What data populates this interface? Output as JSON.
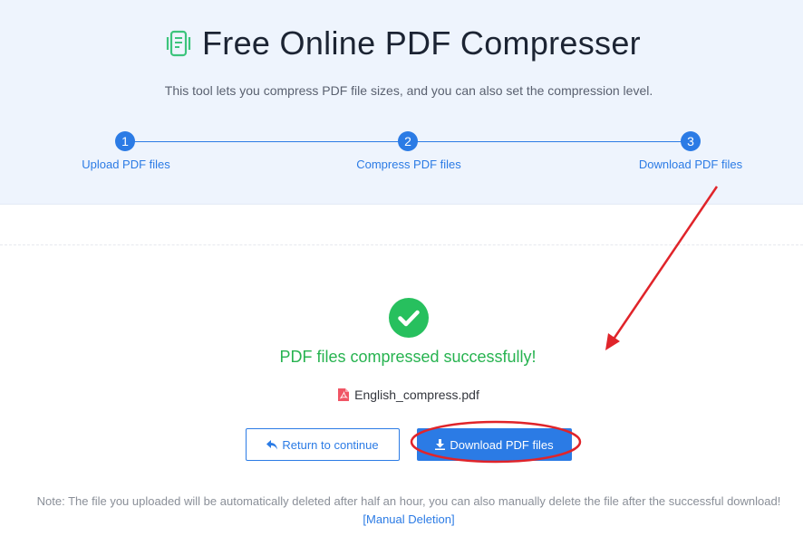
{
  "header": {
    "title": "Free Online PDF Compresser",
    "subtitle": "This tool lets you compress PDF file sizes, and you can also set the compression level.",
    "icon": "document-compress-icon"
  },
  "steps": [
    {
      "number": "1",
      "label": "Upload PDF files"
    },
    {
      "number": "2",
      "label": "Compress PDF files"
    },
    {
      "number": "3",
      "label": "Download PDF files"
    }
  ],
  "result": {
    "status_icon": "check-circle-icon",
    "message": "PDF files compressed successfully!",
    "file_icon": "pdf-file-icon",
    "file_name": "English_compress.pdf"
  },
  "actions": {
    "return_label": "Return to continue",
    "return_icon": "reply-arrow-icon",
    "download_label": "Download PDF files",
    "download_icon": "download-icon"
  },
  "footer": {
    "note": "Note: The file you uploaded will be automatically deleted after half an hour, you can also manually delete the file after the successful download!",
    "manual_deletion_link": "[Manual Deletion]"
  },
  "colors": {
    "accent": "#2b7be5",
    "success": "#27c05e",
    "hero_background": "#eef4fd",
    "annotation": "#e0242a"
  }
}
